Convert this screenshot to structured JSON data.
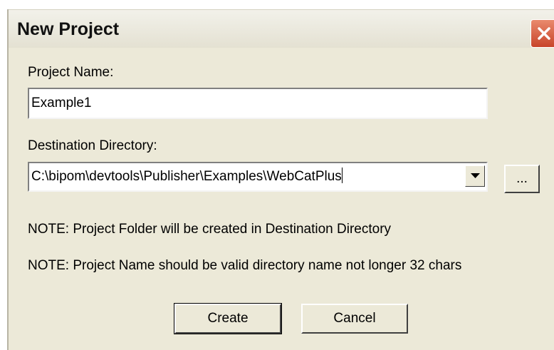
{
  "window": {
    "title": "New Project"
  },
  "form": {
    "project_name_label": "Project Name:",
    "project_name_value": "Example1",
    "destination_label": "Destination Directory:",
    "destination_value": "C:\\bipom\\devtools\\Publisher\\Examples\\WebCatPlus",
    "browse_label": "...",
    "note_folder": "NOTE: Project Folder will be created in Destination Directory",
    "note_name": "NOTE: Project Name should be valid directory name not longer 32 chars"
  },
  "buttons": {
    "create_label": "Create",
    "cancel_label": "Cancel"
  },
  "icons": {
    "close": "close-icon",
    "dropdown": "chevron-down-icon"
  },
  "colors": {
    "dialog_bg": "#ece9d8",
    "close_button": "#c8442a"
  }
}
